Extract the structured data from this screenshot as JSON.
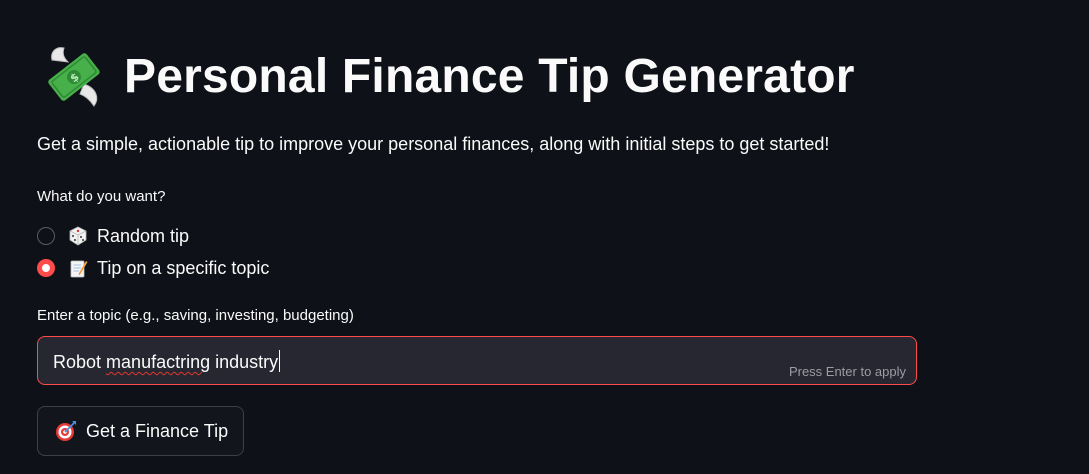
{
  "header": {
    "icon": "money-with-wings-icon",
    "title": "Personal Finance Tip Generator"
  },
  "description": "Get a simple, actionable tip to improve your personal finances, along with initial steps to get started!",
  "mode_question": {
    "label": "What do you want?",
    "options": [
      {
        "icon": "game-die-icon",
        "label": "Random tip",
        "selected": false
      },
      {
        "icon": "memo-icon",
        "label": "Tip on a specific topic",
        "selected": true
      }
    ]
  },
  "topic_input": {
    "label": "Enter a topic (e.g., saving, investing, budgeting)",
    "value_part1": "Robot ",
    "value_misspelled": "manufactring",
    "value_part2": " industry",
    "hint": "Press Enter to apply"
  },
  "submit_button": {
    "icon": "direct-hit-icon",
    "label": "Get a Finance Tip"
  },
  "colors": {
    "background": "#0e1117",
    "accent": "#ff4b4b",
    "input_background": "#262730",
    "text": "#fafafa"
  }
}
